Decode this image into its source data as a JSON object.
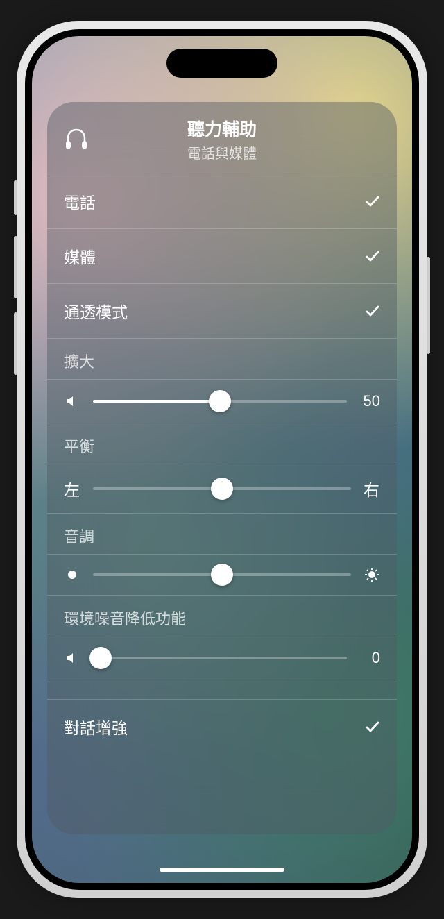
{
  "header": {
    "title": "聽力輔助",
    "subtitle": "電話與媒體"
  },
  "toggles": {
    "phone": {
      "label": "電話",
      "checked": true
    },
    "media": {
      "label": "媒體",
      "checked": true
    },
    "transparency": {
      "label": "通透模式",
      "checked": true
    },
    "conversation_boost": {
      "label": "對話增強",
      "checked": true
    }
  },
  "sliders": {
    "amplification": {
      "label": "擴大",
      "value": 50,
      "percent": 50
    },
    "balance": {
      "label": "平衡",
      "left_label": "左",
      "right_label": "右",
      "percent": 50
    },
    "tone": {
      "label": "音調",
      "percent": 50
    },
    "noise_reduction": {
      "label": "環境噪音降低功能",
      "value": 0,
      "percent": 3
    }
  }
}
